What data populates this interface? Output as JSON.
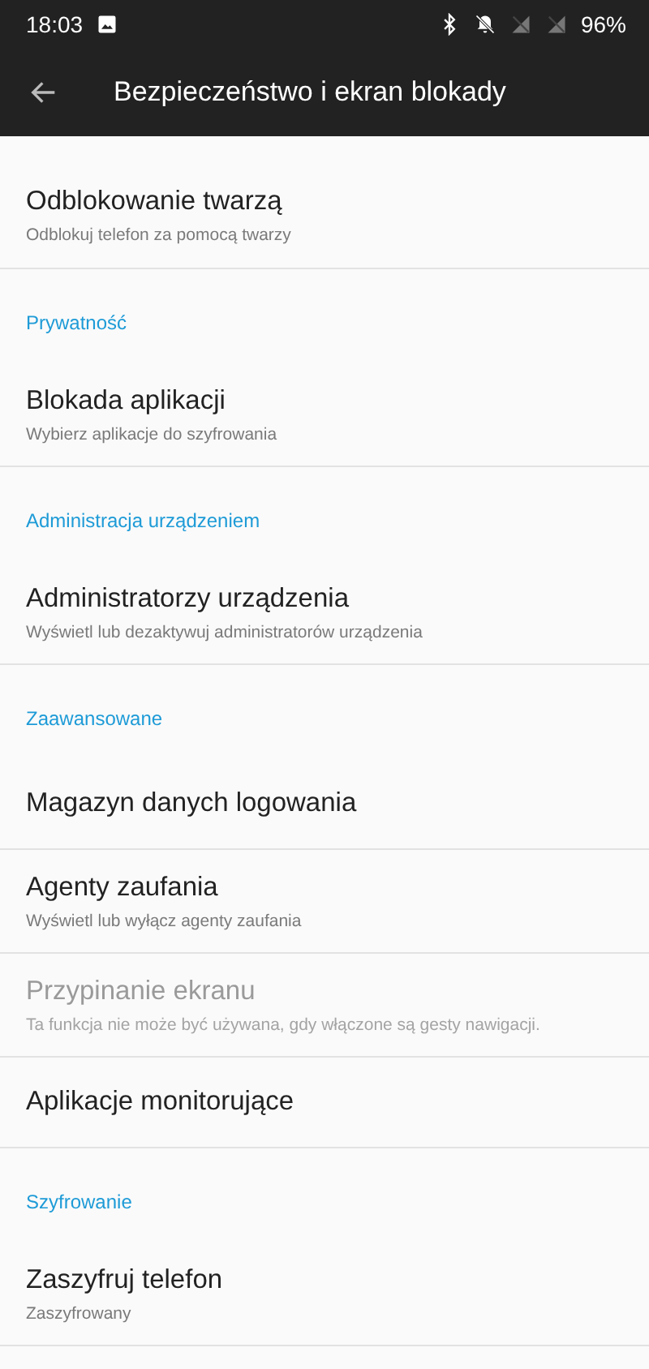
{
  "status_bar": {
    "time": "18:03",
    "battery": "96%"
  },
  "app_bar": {
    "title": "Bezpieczeństwo i ekran blokady"
  },
  "sections": [
    {
      "items": [
        {
          "title": "Odblokowanie twarzą",
          "subtitle": "Odblokuj telefon za pomocą twarzy",
          "disabled": false
        }
      ]
    },
    {
      "header": "Prywatność",
      "items": [
        {
          "title": "Blokada aplikacji",
          "subtitle": "Wybierz aplikacje do szyfrowania",
          "disabled": false
        }
      ]
    },
    {
      "header": "Administracja urządzeniem",
      "items": [
        {
          "title": "Administratorzy urządzenia",
          "subtitle": "Wyświetl lub dezaktywuj administratorów urządzenia",
          "disabled": false
        }
      ]
    },
    {
      "header": "Zaawansowane",
      "items": [
        {
          "title": "Magazyn danych logowania",
          "disabled": false
        },
        {
          "title": "Agenty zaufania",
          "subtitle": "Wyświetl lub wyłącz agenty zaufania",
          "disabled": false
        },
        {
          "title": "Przypinanie ekranu",
          "subtitle": "Ta funkcja nie może być używana, gdy włączone są gesty nawigacji.",
          "disabled": true
        },
        {
          "title": "Aplikacje monitorujące",
          "disabled": false
        }
      ]
    },
    {
      "header": "Szyfrowanie",
      "items": [
        {
          "title": "Zaszyfruj telefon",
          "subtitle": "Zaszyfrowany",
          "disabled": false
        }
      ]
    }
  ]
}
